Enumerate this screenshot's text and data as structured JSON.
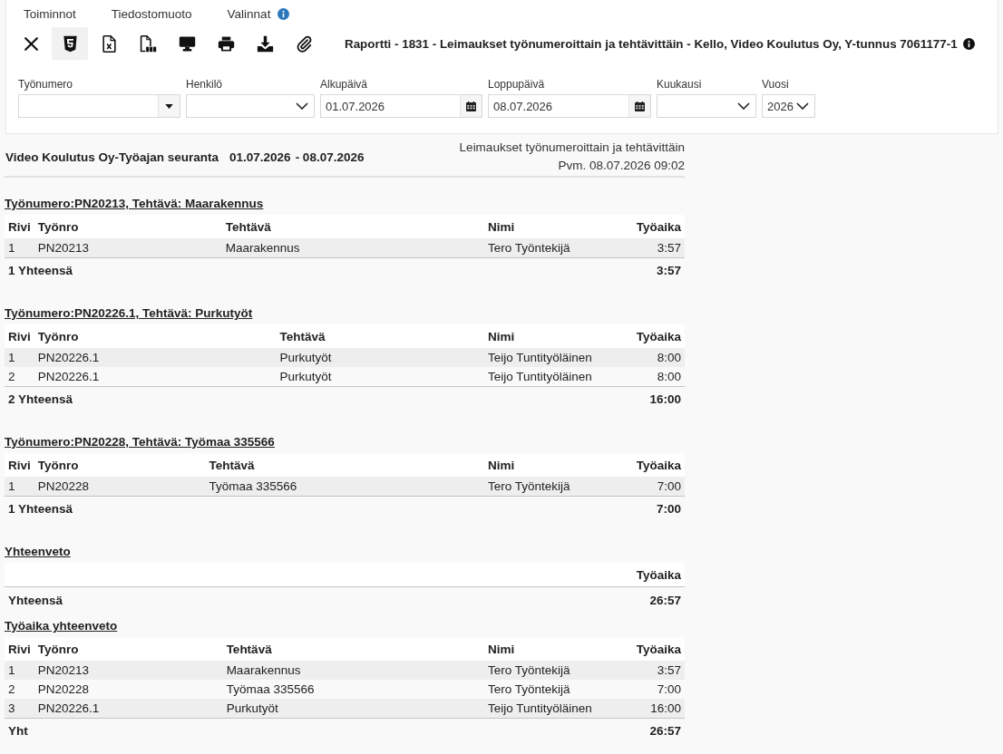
{
  "menu": [
    {
      "label": "Toiminnot",
      "info": false
    },
    {
      "label": "Tiedostomuoto",
      "info": false
    },
    {
      "label": "Valinnat",
      "info": true
    }
  ],
  "toolbar": [
    {
      "kind": "close",
      "selected": false
    },
    {
      "kind": "html",
      "selected": true
    },
    {
      "kind": "excel",
      "selected": false
    },
    {
      "kind": "pdf",
      "selected": false
    },
    {
      "kind": "screen",
      "selected": false
    },
    {
      "kind": "print",
      "selected": false
    },
    {
      "kind": "download",
      "selected": false
    },
    {
      "kind": "attach",
      "selected": false
    }
  ],
  "report_title": "Raportti - 1831 - Leimaukset työnumeroittain ja tehtävittäin - Kello, Video Koulutus Oy, Y-tunnus 7061177-1",
  "filters": [
    {
      "label": "Työnumero",
      "kind": "combo"
    },
    {
      "label": "Henkilö",
      "kind": "select"
    },
    {
      "label": "Alkupäivä",
      "kind": "date",
      "value": "01.07.2026"
    },
    {
      "label": "Loppupäivä",
      "kind": "date",
      "value": "08.07.2026"
    },
    {
      "label": "Kuukausi",
      "kind": "select"
    },
    {
      "label": "Vuosi",
      "kind": "select",
      "value": "2026"
    }
  ],
  "report": {
    "company_title": "Video Koulutus Oy-Työajan seuranta",
    "period_start": "01.07.2026",
    "period_end": "- 08.07.2026",
    "report_name": "Leimaukset työnumeroittain ja tehtävittäin",
    "printed": "Pvm. 08.07.2026 09:02"
  },
  "groups": [
    {
      "heading": "Työnumero:PN20213, Tehtävä: Maarakennus",
      "columns": [
        "Rivi",
        "Työnro",
        "Tehtävä",
        "Nimi",
        "Työaika"
      ],
      "rows": [
        [
          "1",
          "PN20213",
          "Maarakennus",
          "Tero Työntekijä",
          "3:57"
        ]
      ],
      "total": {
        "label": "1 Yhteensä",
        "value": "3:57"
      }
    },
    {
      "heading": "Työnumero:PN20226.1, Tehtävä: Purkutyöt",
      "columns": [
        "Rivi",
        "Työnro",
        "Tehtävä",
        "Nimi",
        "Työaika"
      ],
      "rows": [
        [
          "1",
          "PN20226.1",
          "Purkutyöt",
          "Teijo Tuntityöläinen",
          "8:00"
        ],
        [
          "2",
          "PN20226.1",
          "Purkutyöt",
          "Teijo Tuntityöläinen",
          "8:00"
        ]
      ],
      "total": {
        "label": "2 Yhteensä",
        "value": "16:00"
      }
    },
    {
      "heading": "Työnumero:PN20228, Tehtävä: Työmaa 335566",
      "columns": [
        "Rivi",
        "Työnro",
        "Tehtävä",
        "Nimi",
        "Työaika"
      ],
      "rows": [
        [
          "1",
          "PN20228",
          "Työmaa 335566",
          "Tero Työntekijä",
          "7:00"
        ]
      ],
      "total": {
        "label": "1 Yhteensä",
        "value": "7:00"
      }
    }
  ],
  "summary": {
    "heading": "Yhteenveto",
    "column": "Työaika",
    "total": {
      "label": "Yhteensä",
      "value": "26:57"
    }
  },
  "worktime_summary": {
    "heading": "Työaika yhteenveto",
    "columns": [
      "Rivi",
      "Työnro",
      "Tehtävä",
      "Nimi",
      "Työaika"
    ],
    "rows": [
      [
        "1",
        "PN20213",
        "Maarakennus",
        "Tero Työntekijä",
        "3:57"
      ],
      [
        "2",
        "PN20228",
        "Työmaa 335566",
        "Tero Työntekijä",
        "7:00"
      ],
      [
        "3",
        "PN20226.1",
        "Purkutyöt",
        "Teijo Tuntityöläinen",
        "16:00"
      ]
    ],
    "total": {
      "label": "Yht",
      "value": "26:57"
    }
  }
}
